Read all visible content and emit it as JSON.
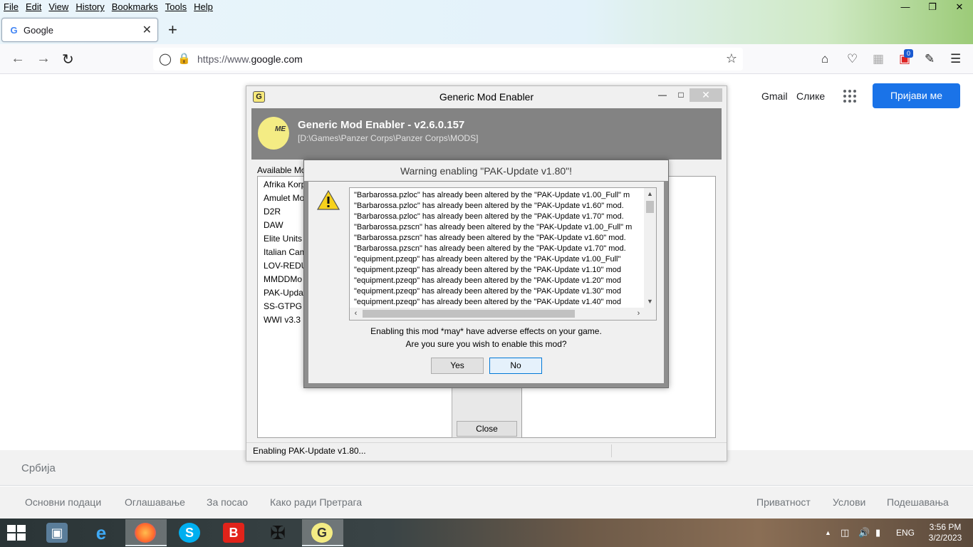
{
  "browser": {
    "menu": [
      "File",
      "Edit",
      "View",
      "History",
      "Bookmarks",
      "Tools",
      "Help"
    ],
    "tab_title": "Google",
    "url_host": "https://www.",
    "url_domain": "google.com",
    "new_tab": "+",
    "badge": "0"
  },
  "google": {
    "gmail": "Gmail",
    "images": "Слике",
    "signin": "Пријави ме",
    "country": "Србија",
    "footer_left": [
      "Основни подаци",
      "Оглашавање",
      "За посао",
      "Како ради Претрага"
    ],
    "footer_right": [
      "Приватност",
      "Услови",
      "Подешавања"
    ]
  },
  "gme": {
    "window_title": "Generic Mod Enabler",
    "header_title": "Generic Mod Enabler - v2.6.0.157",
    "path": "[D:\\Games\\Panzer Corps\\Panzer Corps\\MODS]",
    "available_label": "Available Mo",
    "mods": [
      "Afrika Korp",
      "Amulet Mo",
      "D2R",
      "DAW",
      "Elite Units",
      "Italian Cam",
      "LOV-REDU",
      "MMDDMo",
      "PAK-Updat",
      "SS-GTPG G",
      "WWI v3.3"
    ],
    "close_button": "Close",
    "status": "Enabling PAK-Update v1.80..."
  },
  "dialog": {
    "title": "Warning enabling \"PAK-Update v1.80\"!",
    "log": [
      "\"Barbarossa.pzloc\" has already been altered by the \"PAK-Update v1.00_Full\" m",
      "\"Barbarossa.pzloc\" has already been altered by the \"PAK-Update v1.60\" mod.",
      "\"Barbarossa.pzloc\" has already been altered by the \"PAK-Update v1.70\" mod.",
      "\"Barbarossa.pzscn\" has already been altered by the \"PAK-Update v1.00_Full\" m",
      "\"Barbarossa.pzscn\" has already been altered by the \"PAK-Update v1.60\" mod.",
      "\"Barbarossa.pzscn\" has already been altered by the \"PAK-Update v1.70\" mod.",
      "\"equipment.pzeqp\" has already been altered by the \"PAK-Update v1.00_Full\"",
      "\"equipment.pzeqp\" has already been altered by the \"PAK-Update v1.10\" mod",
      "\"equipment.pzeqp\" has already been altered by the \"PAK-Update v1.20\" mod",
      "\"equipment.pzeqp\" has already been altered by the \"PAK-Update v1.30\" mod",
      "\"equipment.pzeqp\" has already been altered by the \"PAK-Update v1.40\" mod"
    ],
    "message_line1": "Enabling this mod *may* have adverse effects on your game.",
    "message_line2": "Are you sure you wish to enable this mod?",
    "yes": "Yes",
    "no": "No"
  },
  "taskbar": {
    "lang": "ENG",
    "time": "3:56 PM",
    "date": "3/2/2023"
  }
}
